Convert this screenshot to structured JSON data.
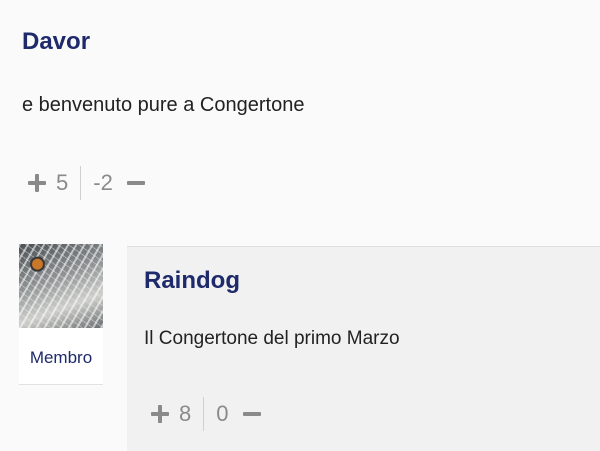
{
  "comments": [
    {
      "author": "Davor",
      "text": "e benvenuto pure a Congertone",
      "upvotes": "5",
      "downvotes": "-2"
    },
    {
      "author": "Raindog",
      "role": "Membro",
      "text": "Il Congertone del primo Marzo",
      "upvotes": "8",
      "downvotes": "0"
    }
  ],
  "icons": {
    "upvote": "plus-icon",
    "downvote": "minus-icon"
  },
  "colors": {
    "author": "#1e2a6b",
    "vote": "#8a8a8a"
  }
}
